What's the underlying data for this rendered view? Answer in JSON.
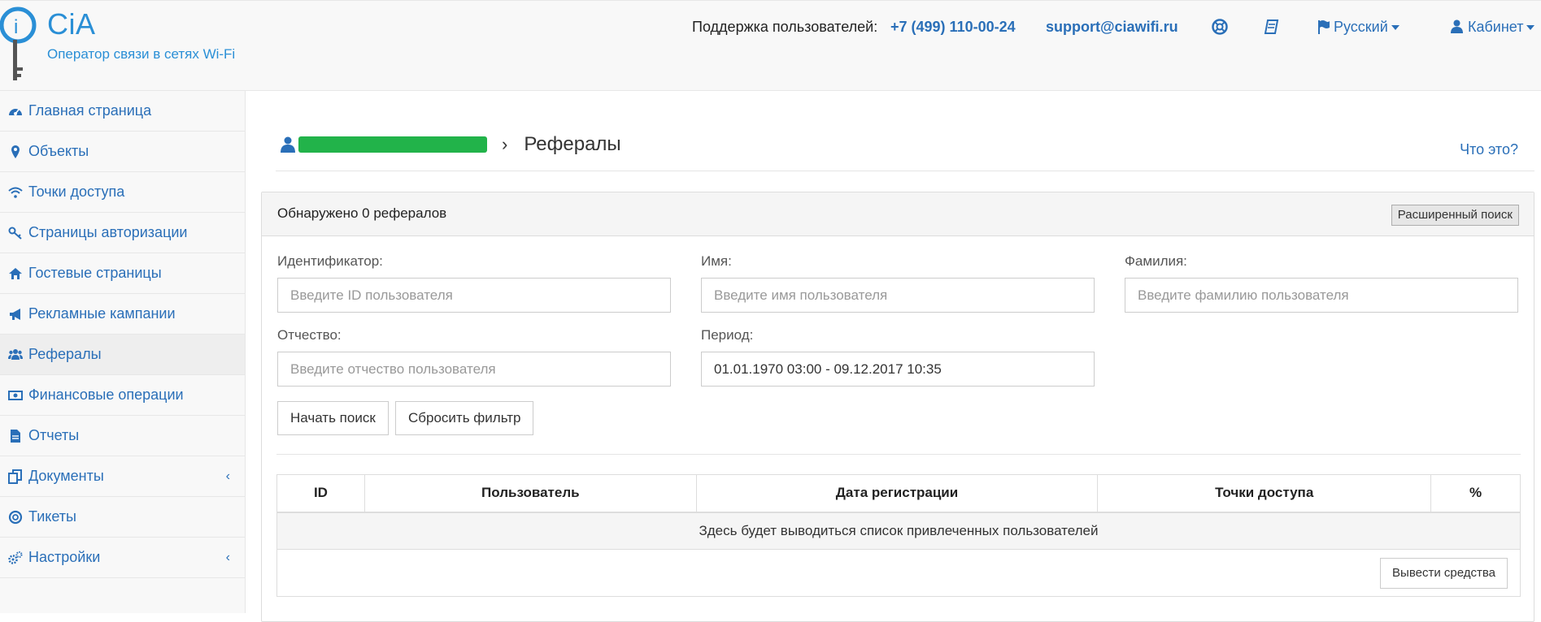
{
  "header": {
    "brand": "CiA",
    "tagline": "Оператор связи в сетях Wi-Fi",
    "support_label": "Поддержка пользователей:",
    "support_phone": "+7 (499) 110-00-24",
    "support_email": "support@ciawifi.ru",
    "help_icon": "lifebuoy-icon",
    "docs_icon": "book-icon",
    "language": "Русский",
    "cabinet": "Кабинет"
  },
  "sidebar": {
    "items": [
      {
        "label": "Главная страница",
        "icon": "dashboard-icon"
      },
      {
        "label": "Объекты",
        "icon": "map-marker-icon"
      },
      {
        "label": "Точки доступа",
        "icon": "wifi-icon"
      },
      {
        "label": "Страницы авторизации",
        "icon": "key-icon"
      },
      {
        "label": "Гостевые страницы",
        "icon": "home-icon"
      },
      {
        "label": "Рекламные кампании",
        "icon": "bullhorn-icon"
      },
      {
        "label": "Рефералы",
        "icon": "users-icon"
      },
      {
        "label": "Финансовые операции",
        "icon": "money-icon"
      },
      {
        "label": "Отчеты",
        "icon": "file-icon"
      },
      {
        "label": "Документы",
        "icon": "files-icon"
      },
      {
        "label": "Тикеты",
        "icon": "lifebuoy-icon"
      },
      {
        "label": "Настройки",
        "icon": "cogs-icon"
      }
    ],
    "active": "Рефералы"
  },
  "main": {
    "breadcrumb_title": "Рефералы",
    "help_link": "Что это?",
    "panel_title": "Обнаружено 0 рефералов",
    "advanced_search": "Расширенный поиск",
    "filters": {
      "id_label": "Идентификатор:",
      "id_placeholder": "Введите ID пользователя",
      "name_label": "Имя:",
      "name_placeholder": "Введите имя пользователя",
      "surname_label": "Фамилия:",
      "surname_placeholder": "Введите фамилию пользователя",
      "patronymic_label": "Отчество:",
      "patronymic_placeholder": "Введите отчество пользователя",
      "period_label": "Период:",
      "period_value": "01.01.1970 03:00 - 09.12.2017 10:35"
    },
    "buttons": {
      "search": "Начать поиск",
      "reset": "Сбросить фильтр",
      "withdraw": "Вывести средства"
    },
    "table": {
      "columns": [
        "ID",
        "Пользователь",
        "Дата регистрации",
        "Точки доступа",
        "%"
      ],
      "empty_text": "Здесь будет выводиться список привлеченных пользователей"
    }
  }
}
